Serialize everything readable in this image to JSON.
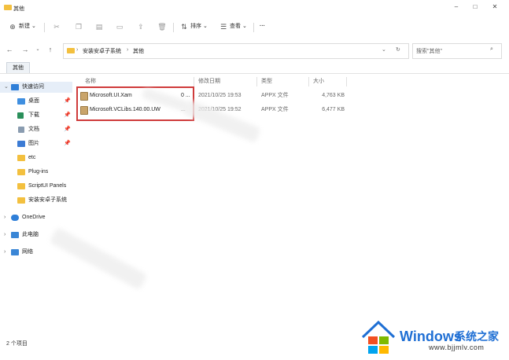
{
  "window": {
    "title": "其他",
    "controls": [
      "minimize-icon",
      "maximize-icon",
      "close-icon"
    ]
  },
  "toolbar": {
    "new_label": "新建",
    "sort_label": "排序",
    "view_label": "查看",
    "more_label": "···"
  },
  "address": {
    "segments": [
      "安装安卓子系统",
      "其他"
    ],
    "search_placeholder": "搜索\"其他\""
  },
  "tabs": [
    "其他"
  ],
  "sidebar": {
    "quick_access": "快速访问",
    "items": [
      {
        "label": "桌面",
        "icon": "desktop-icon",
        "pinned": true
      },
      {
        "label": "下载",
        "icon": "download-icon",
        "pinned": true
      },
      {
        "label": "文档",
        "icon": "document-icon",
        "pinned": true
      },
      {
        "label": "图片",
        "icon": "picture-icon",
        "pinned": true
      },
      {
        "label": "etc",
        "icon": "folder-icon",
        "pinned": false
      },
      {
        "label": "Plug-ins",
        "icon": "folder-icon",
        "pinned": false
      },
      {
        "label": "ScriptUI Panels",
        "icon": "folder-icon",
        "pinned": false
      },
      {
        "label": "安装安卓子系统",
        "icon": "folder-icon",
        "pinned": false
      }
    ],
    "onedrive": "OneDrive",
    "this_pc": "此电脑",
    "network": "网络"
  },
  "columns": [
    "名称",
    "修改日期",
    "类型",
    "大小"
  ],
  "files": [
    {
      "name": "Microsoft.UI.Xam",
      "name_tail": "0 ...",
      "date": "2021/10/25 19:53",
      "type": "APPX 文件",
      "size": "4,763 KB"
    },
    {
      "name": "Microsoft.VCLibs.140.00.UW",
      "name_tail": "...",
      "date": "2021/10/25 19:52",
      "type": "APPX 文件",
      "size": "6,477 KB"
    }
  ],
  "status": {
    "count": "2 个项目"
  },
  "watermark": {
    "brand": "Windows",
    "cn": "系统之家",
    "url": "www.bjjmlv.com",
    "colors": [
      "#f25022",
      "#7fba00",
      "#00a4ef",
      "#ffb900"
    ]
  }
}
